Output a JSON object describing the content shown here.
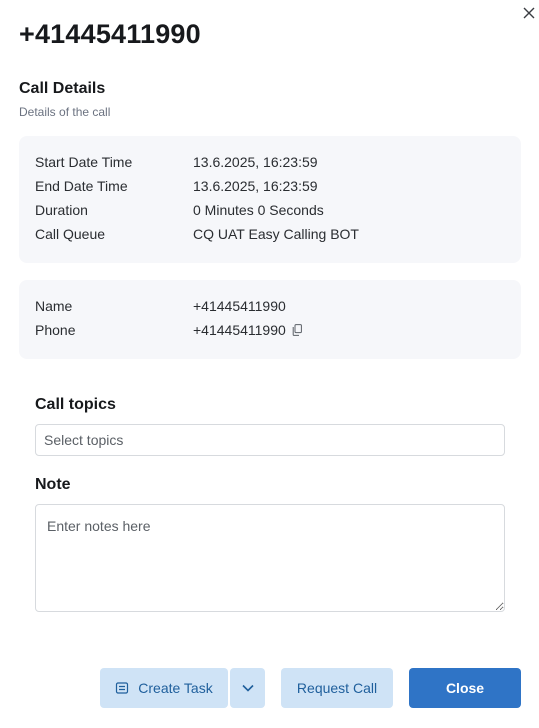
{
  "header": {
    "phone_title": "+41445411990"
  },
  "call_details": {
    "title": "Call Details",
    "subtitle": "Details of the call",
    "rows": [
      {
        "key": "Start Date Time",
        "value": "13.6.2025, 16:23:59"
      },
      {
        "key": "End Date Time",
        "value": "13.6.2025, 16:23:59"
      },
      {
        "key": "Duration",
        "value": "0 Minutes 0 Seconds"
      },
      {
        "key": "Call Queue",
        "value": "CQ UAT Easy Calling BOT"
      }
    ]
  },
  "contact": {
    "rows": [
      {
        "key": "Name",
        "value": "+41445411990"
      },
      {
        "key": "Phone",
        "value": "+41445411990"
      }
    ]
  },
  "form": {
    "topics_label": "Call topics",
    "topics_placeholder": "Select topics",
    "note_label": "Note",
    "note_placeholder": "Enter notes here"
  },
  "footer": {
    "create_task_label": "Create Task",
    "request_call_label": "Request Call",
    "close_label": "Close"
  },
  "colors": {
    "primary": "#2f74c6",
    "light_button": "#cfe3f6",
    "card_background": "#f6f7fa"
  },
  "icons": [
    "close-icon",
    "copy-icon",
    "task-icon",
    "chevron-down-icon"
  ]
}
